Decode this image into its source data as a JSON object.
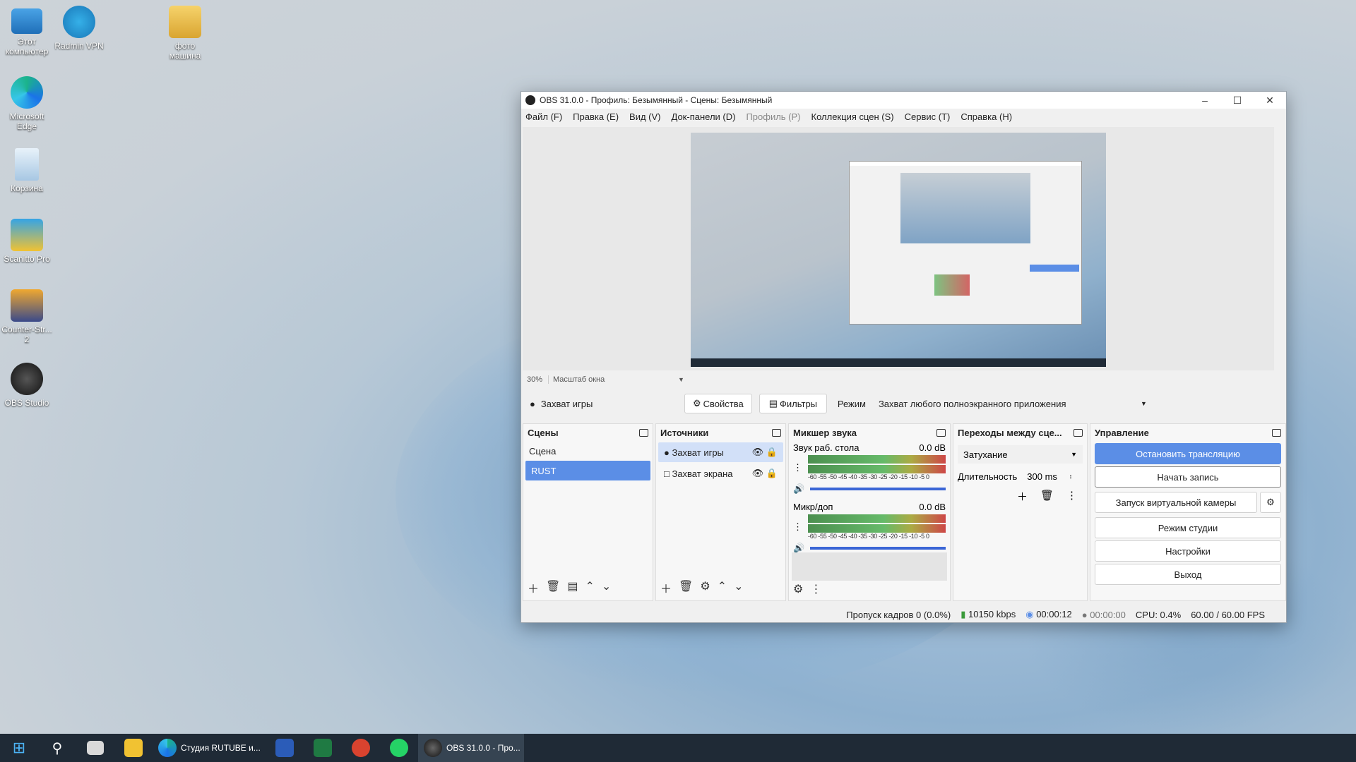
{
  "desktop": {
    "icons": [
      {
        "label": "Этот компьютер"
      },
      {
        "label": "Radmin VPN"
      },
      {
        "label": "фото машина"
      },
      {
        "label": "Microsoft Edge"
      },
      {
        "label": "Корзина"
      },
      {
        "label": "Scanitto Pro"
      },
      {
        "label": "Counter-Str... 2"
      },
      {
        "label": "OBS Studio"
      }
    ]
  },
  "obs": {
    "title": "OBS 31.0.0 - Профиль: Безымянный - Сцены: Безымянный",
    "menu": [
      "Файл (F)",
      "Правка (E)",
      "Вид (V)",
      "Док-панели (D)",
      "Профиль (P)",
      "Коллекция сцен (S)",
      "Сервис (T)",
      "Справка (H)"
    ],
    "zoom": "30%",
    "zoom_mode": "Масштаб окна",
    "source_bar": {
      "source": "Захват игры",
      "properties": "Свойства",
      "filters": "Фильтры",
      "mode_label": "Режим",
      "mode_value": "Захват любого полноэкранного приложения"
    },
    "scenes": {
      "title": "Сцены",
      "items": [
        "Сцена",
        "RUST"
      ],
      "selected": 1
    },
    "sources": {
      "title": "Источники",
      "items": [
        "Захват игры",
        "Захват экрана"
      ],
      "selected": 0
    },
    "mixer": {
      "title": "Микшер звука",
      "scale": "-60 -55 -50 -45 -40 -35 -30 -25 -20 -15 -10 -5 0",
      "channels": [
        {
          "name": "Звук раб. стола",
          "db": "0.0 dB",
          "volume": 0.95
        },
        {
          "name": "Микр/доп",
          "db": "0.0 dB",
          "volume": 0.95
        }
      ]
    },
    "transitions": {
      "title": "Переходы между сце...",
      "type": "Затухание",
      "duration_label": "Длительность",
      "duration": "300 ms"
    },
    "controls": {
      "title": "Управление",
      "stop_stream": "Остановить трансляцию",
      "start_rec": "Начать запись",
      "virtual_cam": "Запуск виртуальной камеры",
      "studio": "Режим студии",
      "settings": "Настройки",
      "exit": "Выход"
    },
    "status": {
      "dropped": "Пропуск кадров 0 (0.0%)",
      "bitrate": "10150 kbps",
      "stream_time": "00:00:12",
      "rec_time": "00:00:00",
      "cpu": "CPU: 0.4%",
      "fps": "60.00 / 60.00 FPS"
    }
  },
  "taskbar": {
    "edge_label": "Студия RUTUBE и...",
    "obs_label": "OBS 31.0.0 - Про..."
  },
  "colors": {
    "accent": "#5b8ee6",
    "taskbar": "#1f2a36"
  }
}
